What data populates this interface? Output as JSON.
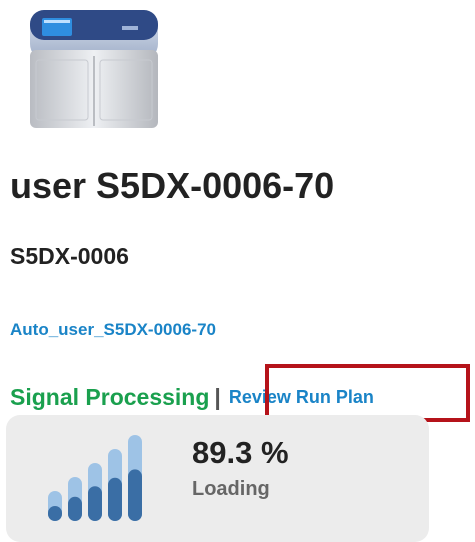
{
  "run": {
    "title": "user S5DX-0006-70",
    "instrument_name": "S5DX-0006",
    "run_link": "Auto_user_S5DX-0006-70"
  },
  "status": {
    "stage": "Signal Processing",
    "separator": "|",
    "review_link": "Review Run Plan"
  },
  "progress": {
    "percent_label": "89.3 %",
    "percent_value": 89.3,
    "phase": "Loading",
    "bar_levels": [
      0.5,
      0.55,
      0.6,
      0.6,
      0.6
    ]
  },
  "colors": {
    "stage_green": "#1aa04e",
    "link_blue": "#1a84c7",
    "highlight_red": "#b5131a",
    "bar_dark": "#3a6ea5",
    "bar_light": "#9ec3e6"
  },
  "icons": {
    "instrument": "sequencer-instrument-icon",
    "signal": "signal-bars-icon"
  }
}
